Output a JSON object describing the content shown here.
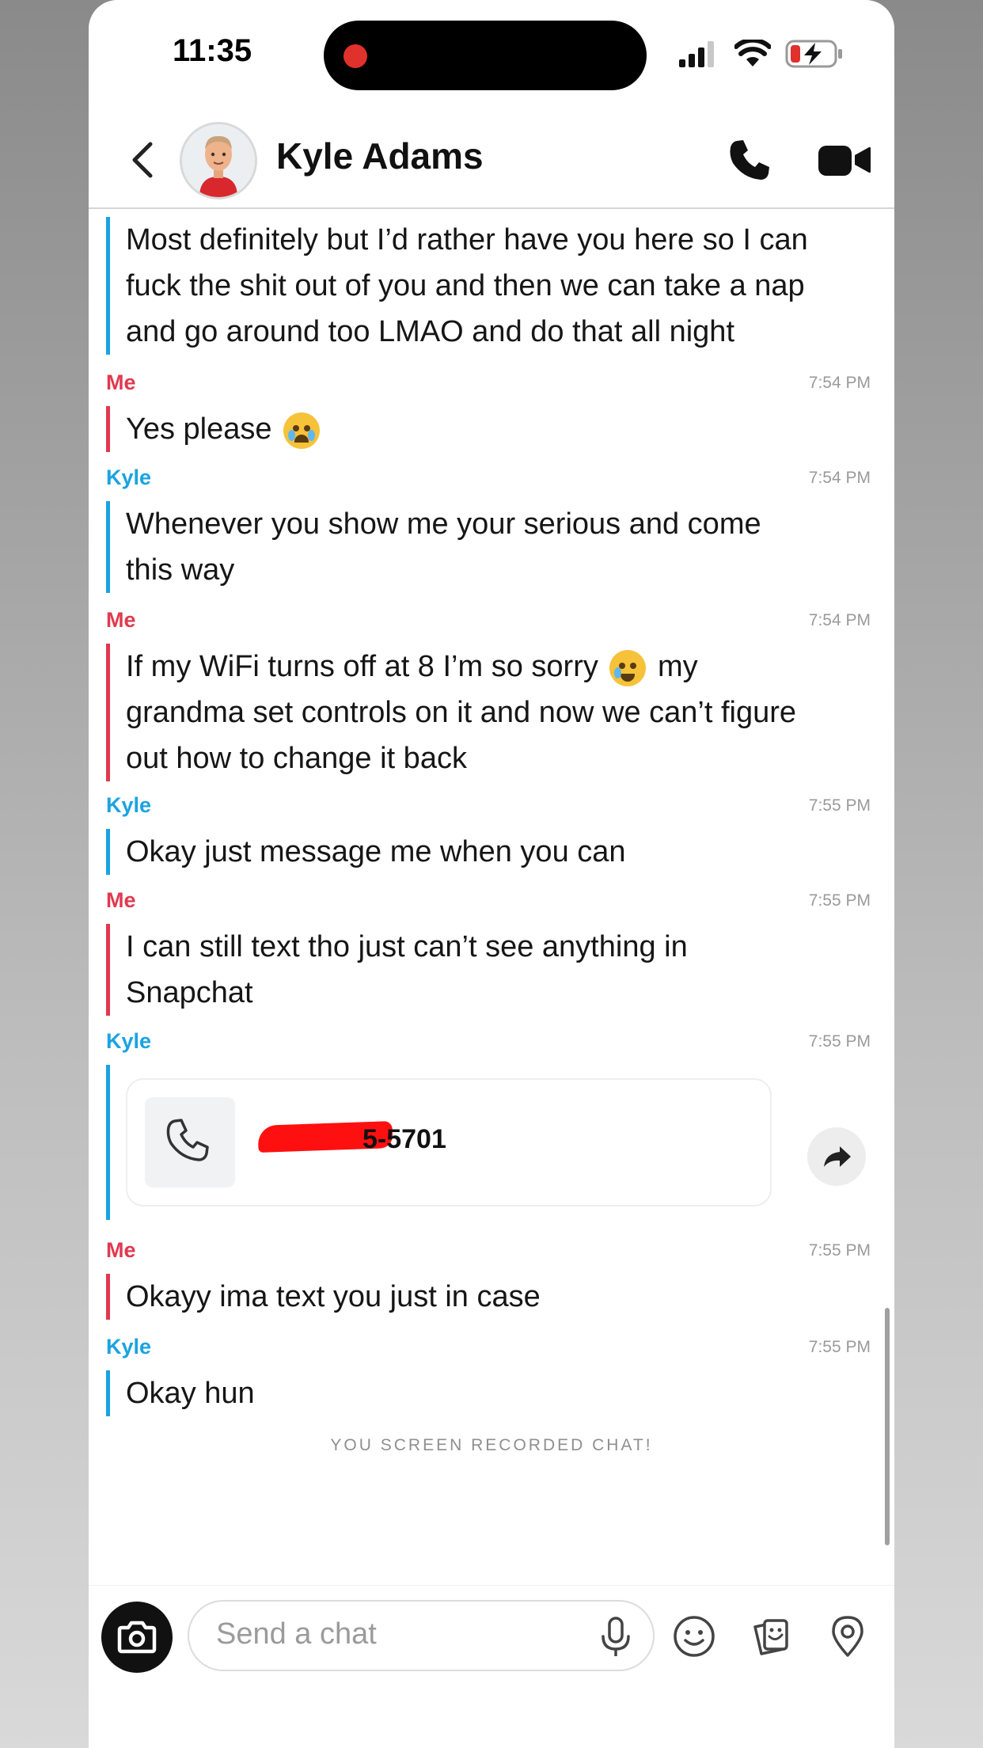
{
  "status_bar": {
    "time": "11:35"
  },
  "header": {
    "contact_name": "Kyle Adams"
  },
  "messages": [
    {
      "sender": "",
      "time": "",
      "lines": [
        "Most definitely but I’d rather have you here so I can",
        "fuck the shit out of you and then we can take a nap",
        "and go around too LMAO and do that all night"
      ]
    },
    {
      "sender": "Me",
      "time": "7:54 PM",
      "lines": [
        "Yes please"
      ]
    },
    {
      "sender": "Kyle",
      "time": "7:54 PM",
      "lines": [
        "Whenever you show me your serious and come",
        "this way"
      ]
    },
    {
      "sender": "Me",
      "time": "7:54 PM",
      "lines": [
        "If my WiFi turns off at 8 I’m so sorry",
        "my",
        "grandma set controls on it and now we can’t figure",
        "out how to change it back"
      ]
    },
    {
      "sender": "Kyle",
      "time": "7:55 PM",
      "lines": [
        "Okay just message me when you can"
      ]
    },
    {
      "sender": "Me",
      "time": "7:55 PM",
      "lines": [
        "I can still text tho just can’t see anything in",
        "Snapchat"
      ]
    },
    {
      "sender": "Kyle",
      "time": "7:55 PM",
      "card_number": "5-5701"
    },
    {
      "sender": "Me",
      "time": "7:55 PM",
      "lines": [
        "Okayy ima text you just in case"
      ]
    },
    {
      "sender": "Kyle",
      "time": "7:55 PM",
      "lines": [
        "Okay hun"
      ]
    }
  ],
  "system_note": "YOU SCREEN RECORDED CHAT!",
  "composer": {
    "placeholder": "Send a chat"
  },
  "colors": {
    "me": "#e0394f",
    "kyle": "#1aa3e2",
    "recording": "#e0312c"
  },
  "icons": [
    "back-chevron-icon",
    "phone-icon",
    "video-icon",
    "camera-icon",
    "microphone-icon",
    "smiley-icon",
    "stickers-icon",
    "location-pin-icon",
    "share-arrow-icon"
  ]
}
